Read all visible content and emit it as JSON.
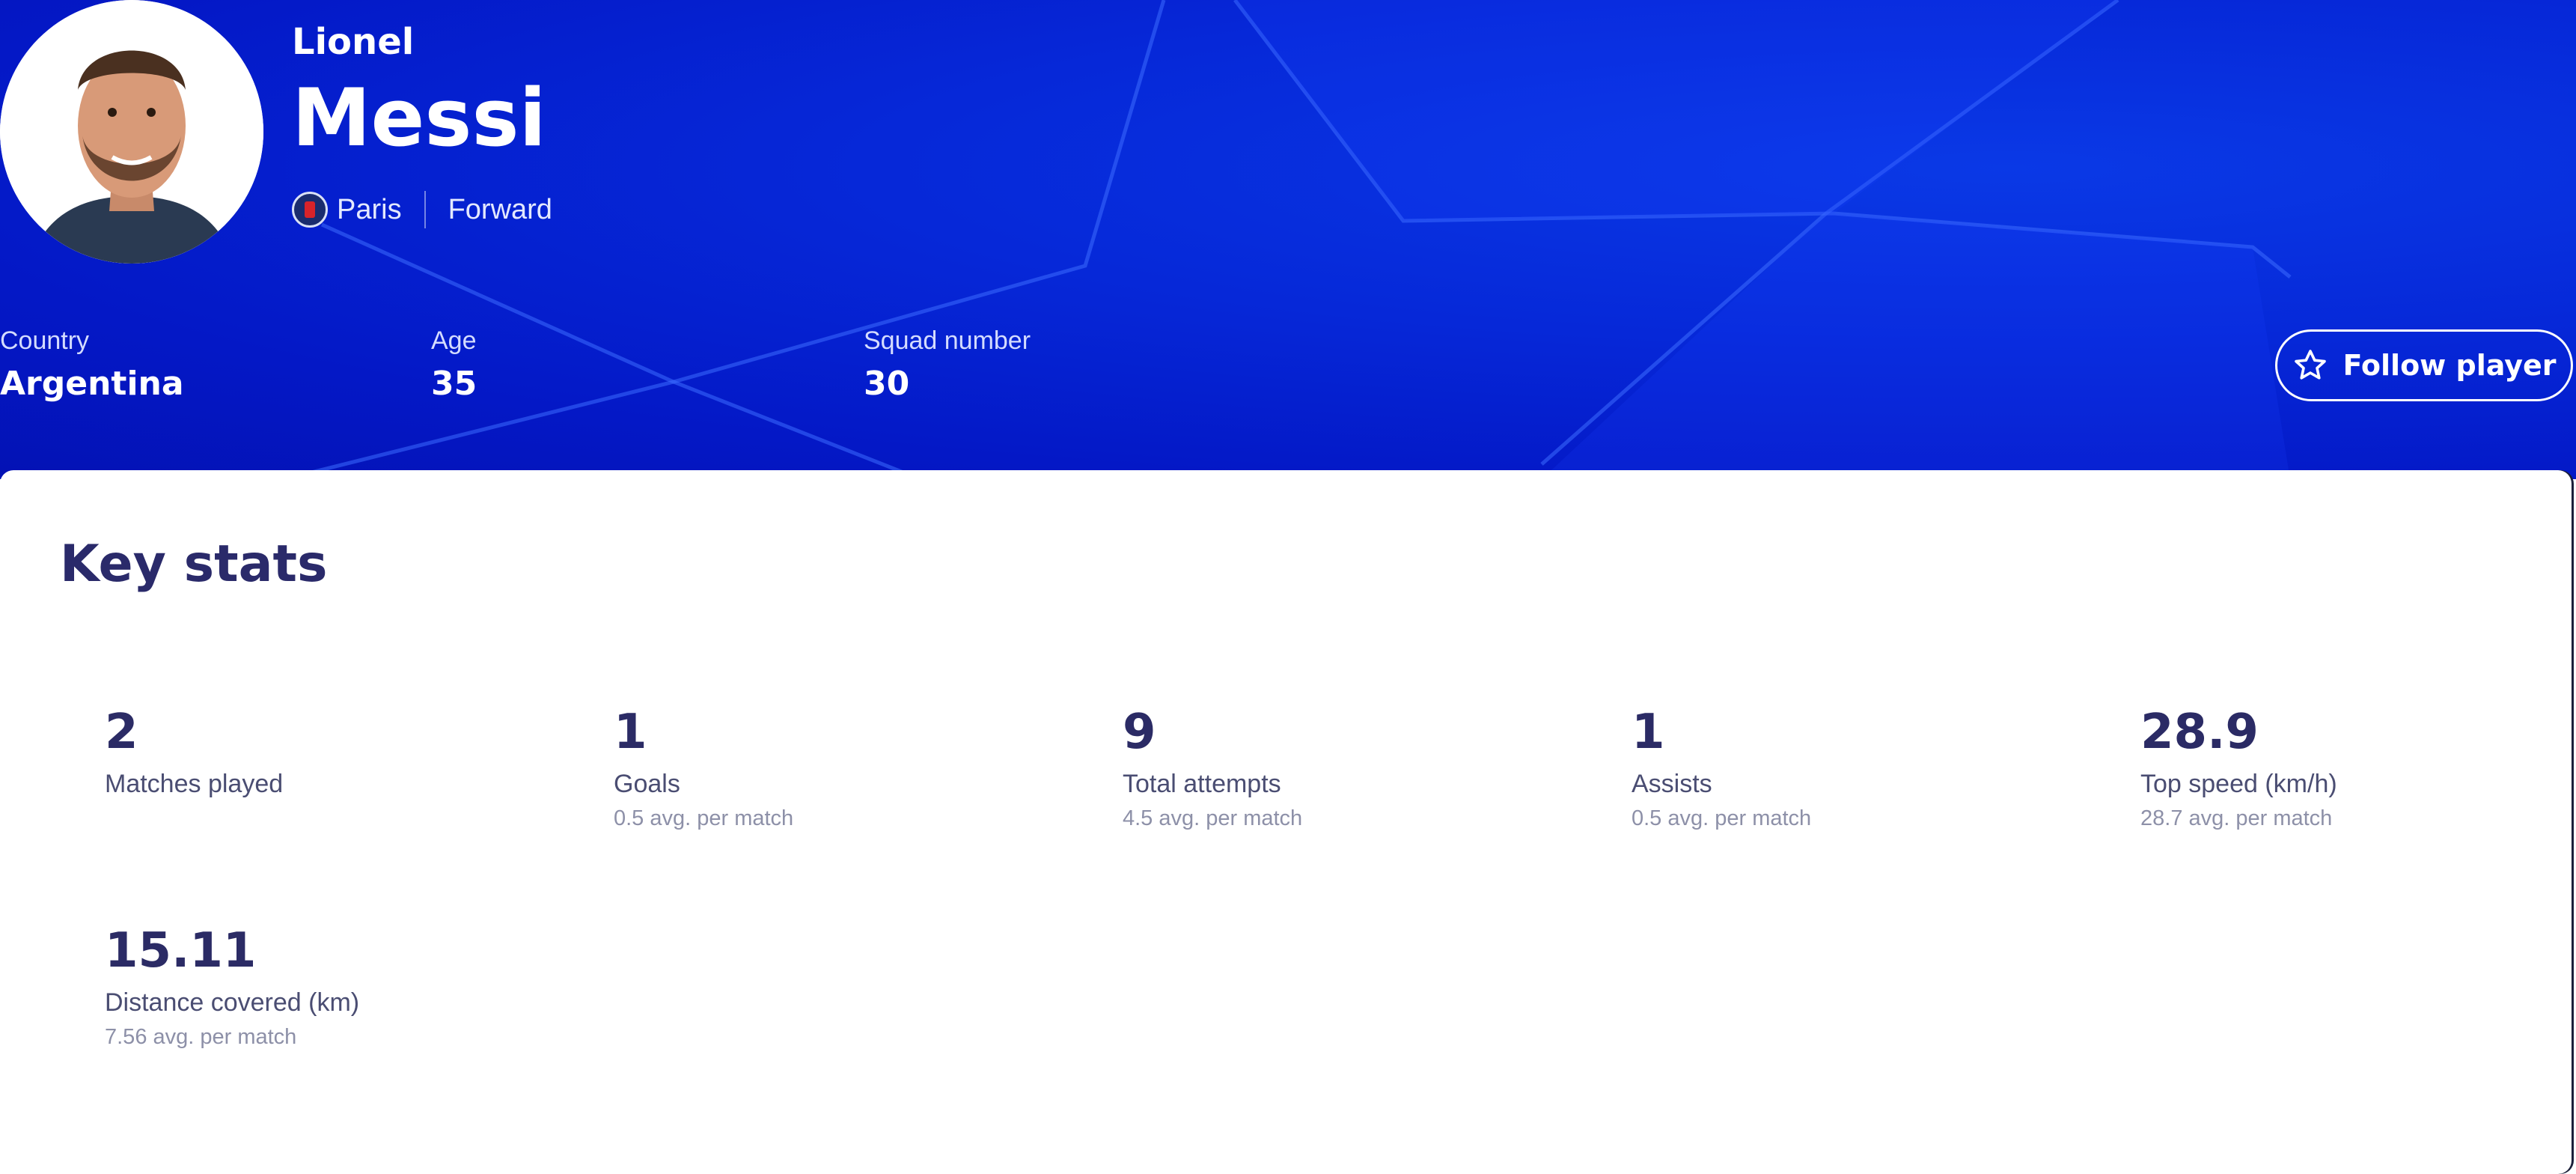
{
  "player": {
    "first_name": "Lionel",
    "last_name": "Messi",
    "club": "Paris",
    "position": "Forward",
    "photo_icon": "player-photo"
  },
  "info": {
    "country_label": "Country",
    "country_value": "Argentina",
    "age_label": "Age",
    "age_value": "35",
    "squad_label": "Squad number",
    "squad_value": "30"
  },
  "follow_button": {
    "label": "Follow player",
    "icon": "star-outline-icon"
  },
  "key_stats": {
    "title": "Key stats",
    "items": [
      {
        "value": "2",
        "label": "Matches played",
        "sub": ""
      },
      {
        "value": "1",
        "label": "Goals",
        "sub": "0.5 avg. per match"
      },
      {
        "value": "9",
        "label": "Total attempts",
        "sub": "4.5 avg. per match"
      },
      {
        "value": "1",
        "label": "Assists",
        "sub": "0.5 avg. per match"
      },
      {
        "value": "28.9",
        "label": "Top speed (km/h)",
        "sub": "28.7 avg. per match"
      },
      {
        "value": "15.11",
        "label": "Distance covered (km)",
        "sub": "7.56 avg. per match"
      }
    ]
  },
  "colors": {
    "hero_blue": "#0628d8",
    "stat_text": "#2b2b65",
    "white": "#ffffff"
  }
}
